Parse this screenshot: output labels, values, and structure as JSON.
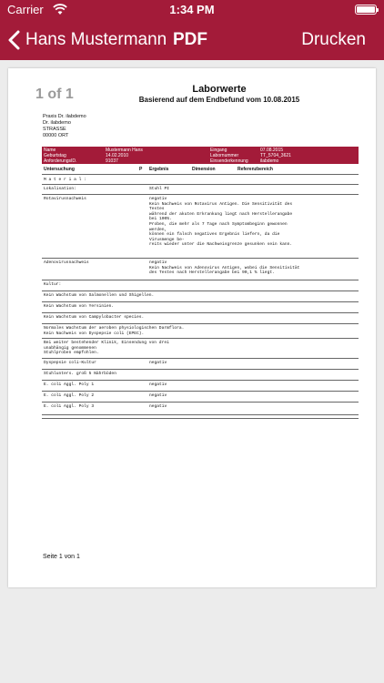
{
  "status": {
    "carrier": "Carrier",
    "time": "1:34 PM"
  },
  "nav": {
    "back_label": "Hans Mustermann",
    "title": "PDF",
    "print_label": "Drucken"
  },
  "pdf": {
    "page_indicator": "1 of 1",
    "title": "Laborwerte",
    "subtitle": "Basierend auf dem Endbefund vom 10.08.2015",
    "address": [
      "Praxis Dr. ilabdemo",
      "Dr. ilabdemo",
      "STRASSE",
      "00000 ORT"
    ],
    "info": {
      "name_label": "Name",
      "name_value": "Mustermann Hans",
      "birth_label": "Geburtstag",
      "birth_value": "14.02.2010",
      "request_label": "AnforderungsID.",
      "request_value": "91037",
      "entry_label": "Eingang",
      "entry_value": "07.08.2015",
      "lab_label": "Labornummer",
      "lab_value": "TT_5704_3621",
      "sender_label": "Einsenderkennung",
      "sender_value": "ilabdemo"
    },
    "headers": {
      "test": "Untersuchung",
      "p": "P",
      "result": "Ergebnis",
      "dimension": "Dimension",
      "reference": "Referenzbereich"
    },
    "rows": {
      "material": "M a t e r i a l :",
      "lokalisation_test": "Lokalisation:",
      "lokalisation_result": "Stuhl PI",
      "rota_test": "Rotavirusnachweis",
      "rota_result": "negativ\nKein Nachweis von Rotavirus Antigen. Die Sensitivität des\nTestes\nwährend der akuten Erkrankung liegt nach Herstellerangabe\nbei 100%.\nProben, die mehr als 7 Tage nach Symptombeginn gewonnen\nwerden,\nkönnen ein falsch negatives Ergebnis liefern, da die\nVirusmenge be-\nreits wieder unter die Nachweisgrenze gesunken sein kann.",
      "adeno_test": "Adenovirusnachweis",
      "adeno_result": "negativ\nKein Nachweis von Adenovirus Antigen, wobei die Sensitivität\ndes Testes nach Herstellerangabe bei 90,1 % liegt.",
      "kultur": "Kultur:",
      "salmonellen": "Kein Wachstum von Salmonellen und Shigellen.",
      "yersinien": "Kein Wachstum von Yersinien.",
      "campylobacter": "Kein Wachstum von Campylobacter species.",
      "darmflora": "Normales Wachstum der aeroben physiologischen Darmflora.\nKein Nachweis von Dyspepsie coli (EPEC).",
      "klinik": "Bei weiter bestehender Klinik, Einsendung von drei\nunabhängig genommenen\nStuhlproben empfohlen.",
      "dyspepsie_test": "Dyspepsie coli-Kultur",
      "dyspepsie_result": "negativ",
      "stuhlunters": "Stuhlunters. groß 5 Nährböden",
      "ecoli1_test": "E. coli Aggl. Poly 1",
      "ecoli1_result": "negativ",
      "ecoli2_test": "E. coli Aggl. Poly 2",
      "ecoli2_result": "negativ",
      "ecoli3_test": "E. coli Aggl. Poly 3",
      "ecoli3_result": "negativ"
    },
    "footer": "Seite 1 von 1"
  }
}
